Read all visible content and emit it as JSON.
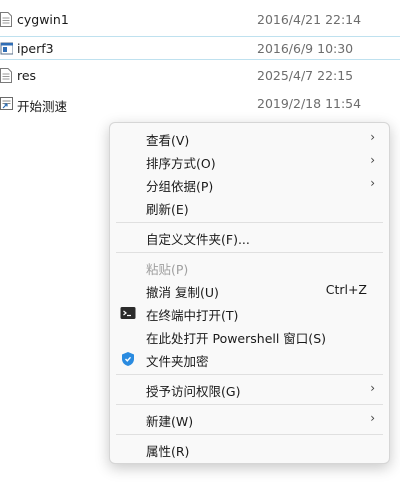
{
  "files": [
    {
      "name": "cygwin1",
      "date": "2016/4/21 22:14",
      "icon": "text-file-icon"
    },
    {
      "name": "iperf3",
      "date": "2016/6/9 10:30",
      "icon": "exe-file-icon"
    },
    {
      "name": "res",
      "date": "2025/4/7 22:15",
      "icon": "text-file-icon"
    },
    {
      "name": "开始测速",
      "date": "2019/2/18 11:54",
      "icon": "shortcut-file-icon"
    }
  ],
  "menu": {
    "view": "查看(V)",
    "sort": "排序方式(O)",
    "group": "分组依据(P)",
    "refresh": "刷新(E)",
    "customize": "自定义文件夹(F)...",
    "paste": "粘贴(P)",
    "undo_copy": "撤消 复制(U)",
    "undo_shortcut": "Ctrl+Z",
    "open_terminal": "在终端中打开(T)",
    "open_powershell": "在此处打开 Powershell 窗口(S)",
    "encrypt": "文件夹加密",
    "grant_access": "授予访问权限(G)",
    "new": "新建(W)",
    "properties": "属性(R)",
    "submenu_arrow": "›"
  },
  "colors": {
    "menu_bg": "#f9f9f9",
    "selected_border": "#bfe1ef",
    "disabled_text": "#9f9f9f",
    "shield_blue": "#2a8be0"
  }
}
